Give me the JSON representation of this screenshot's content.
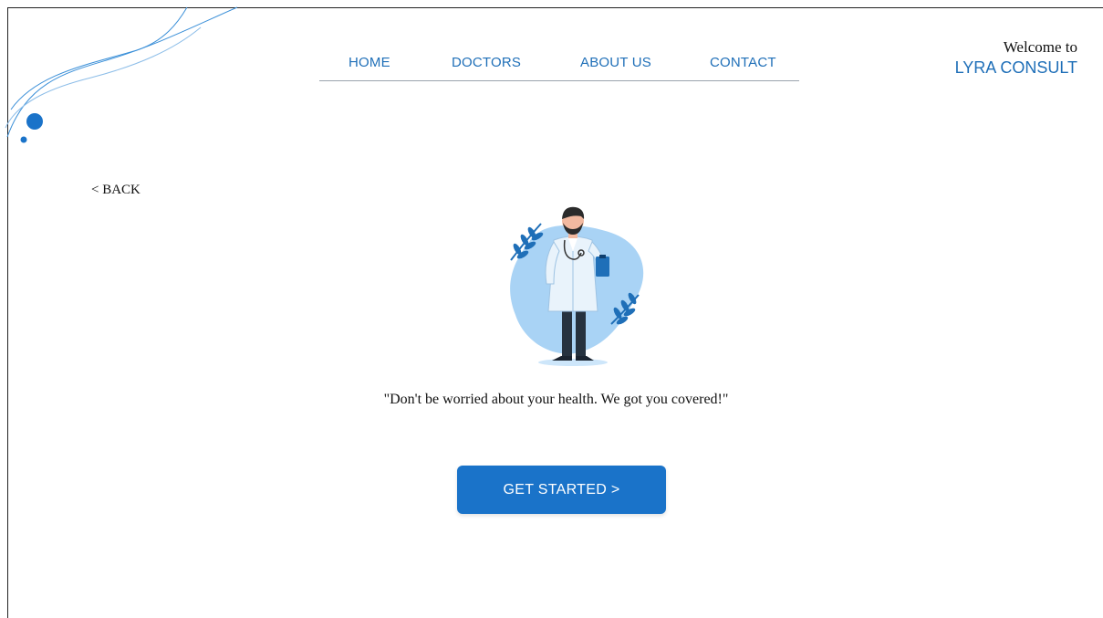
{
  "nav": {
    "items": [
      {
        "label": "HOME"
      },
      {
        "label": "DOCTORS"
      },
      {
        "label": "ABOUT US"
      },
      {
        "label": "CONTACT"
      }
    ]
  },
  "header": {
    "welcome_text": "Welcome to",
    "brand": "LYRA CONSULT"
  },
  "back_label": "< BACK",
  "illustration": {
    "icon": "doctor-illustration"
  },
  "quote": "\"Don't be worried about your health. We got you covered!\"",
  "cta": {
    "label": "GET STARTED  >"
  },
  "colors": {
    "accent": "#1a73c9",
    "nav_text": "#1f6fb8",
    "blob": "#a9d3f5"
  }
}
